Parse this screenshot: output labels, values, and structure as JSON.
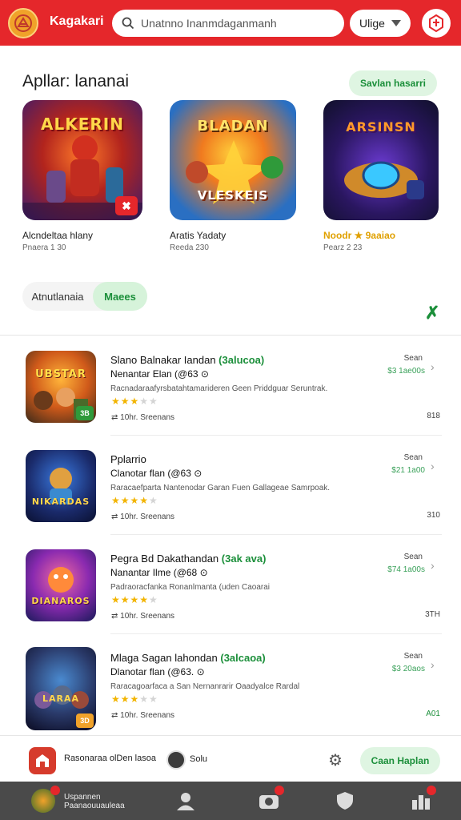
{
  "header": {
    "brand": "Kagakari",
    "search_placeholder": "Unatnno Inanmdaganmanh",
    "language": "Ulige",
    "colors": {
      "primary": "#e5272b",
      "accent": "#1b8f3a",
      "highlight": "#f0a22a"
    }
  },
  "featured": {
    "title": "Apllar: lananai",
    "view_all": "Savlan hasarri",
    "items": [
      {
        "name": "Alcndeltaa hlany",
        "price": "Pnaera 1 30",
        "art_text": "ALKERIN",
        "highlight": false
      },
      {
        "name": "Aratis Yadaty",
        "price": "Reeda 230",
        "art_text_top": "BLADAN",
        "art_text_bottom": "VLESKEIS",
        "highlight": false
      },
      {
        "name": "Noodr ★ 9aaiao",
        "price": "Pearz 2 23",
        "art_text": "ARSINSN",
        "highlight": true
      }
    ]
  },
  "tabs": [
    "Atnutlanaia",
    "Maees"
  ],
  "list": [
    {
      "title": "Slano Balnakar Iandan",
      "tag": "(3alucoa)",
      "subtitle": "Nenantar Elan (@63",
      "desc": "Racnadaraafyrsbatahtamarideren Geen Priddguar Seruntrak.",
      "rating": 3,
      "meta": "10hr. Sreenans",
      "price_label": "Sean",
      "price_value": "$3 1ae00s",
      "count": "818",
      "art_text": "UBSTAR"
    },
    {
      "title": "Pplarrio",
      "tag": "",
      "subtitle": "Clanotar flan (@63",
      "desc": "Raracaefparta Nantenodar Garan Fuen Gallageae Samrpoak.",
      "rating": 4,
      "meta": "10hr. Sreenans",
      "price_label": "Sean",
      "price_value": "$21 1a00",
      "count": "310",
      "art_text": "NIKARDAS"
    },
    {
      "title": "Pegra Bd Dakathandan",
      "tag": "(3ak ava)",
      "subtitle": "Nanantar Ilme (@68",
      "desc": "Padraoracfanka Ronanlmanta (uden Caoarai",
      "rating": 4,
      "meta": "10hr. Sreenans",
      "price_label": "Sean",
      "price_value": "$74 1a00s",
      "count": "3TH",
      "art_text": "DIANAROS"
    },
    {
      "title": "Mlaga Sagan lahondan",
      "tag": "(3alcaoa)",
      "subtitle": "Dlanotar flan (@63.",
      "desc": "Raracagoarfaca a San Nernanrarir Oaadyalce Rardal",
      "rating": 3,
      "meta": "10hr. Sreenans",
      "price_label": "Sean",
      "price_value": "$3 20aos",
      "count": "A01",
      "art_text": "LARAA"
    }
  ],
  "bottom_bar": {
    "store_label": "Rasonaraa olDen lasoa",
    "user_label": "Solu",
    "cta": "Caan Haplan"
  },
  "nav": {
    "label": "Uspannen Paanaouuauleaa"
  }
}
